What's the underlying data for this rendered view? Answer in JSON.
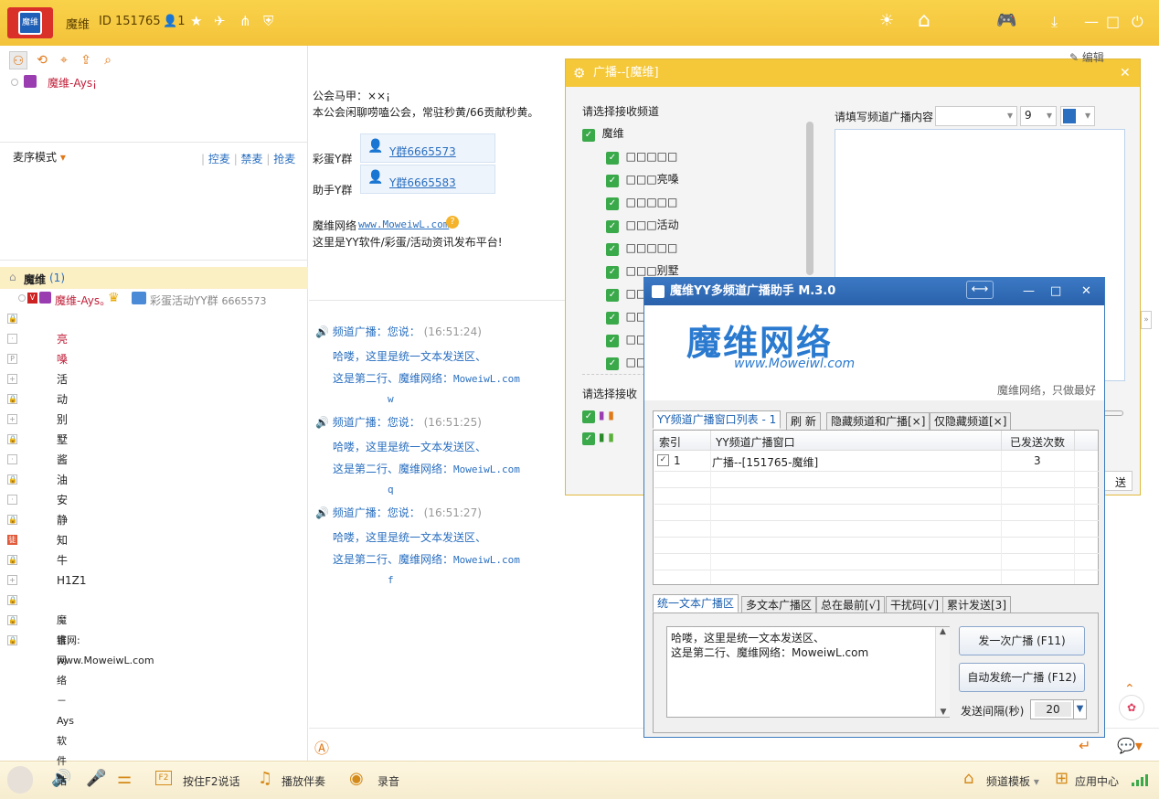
{
  "topbar": {
    "logo_text": "魔维",
    "channel_name": "魔维",
    "id_label": "ID 151765",
    "online_count": "1"
  },
  "left": {
    "user_name": "魔维-Ays¡",
    "mic_mode": "麦序模式",
    "mic_actions": [
      "控麦",
      "禁麦",
      "抢麦"
    ],
    "root_name": "魔维",
    "root_count": "(1)",
    "member_name": "魔维-Ays。",
    "member_group": "彩蛋活动YY群",
    "member_group_id": "6665573",
    "channels": [
      {
        "label": "",
        "icon": "lock"
      },
      {
        "label": "亮嗓",
        "icon": "dot"
      },
      {
        "label": "",
        "icon": "pg"
      },
      {
        "label": "活动",
        "icon": "plus"
      },
      {
        "label": "",
        "icon": "lock"
      },
      {
        "label": "别墅",
        "icon": "plus"
      },
      {
        "label": "",
        "icon": "lock"
      },
      {
        "label": "酱油",
        "icon": "dot"
      },
      {
        "label": "",
        "icon": "lock"
      },
      {
        "label": "安静",
        "icon": "dot"
      },
      {
        "label": "",
        "icon": "lock"
      },
      {
        "label": "知牛",
        "icon": "tu"
      },
      {
        "label": "",
        "icon": "lock"
      },
      {
        "label": "H1Z1",
        "icon": "plus"
      },
      {
        "label": "",
        "icon": "lock"
      },
      {
        "label": "魔维网络－Ays软件站",
        "icon": "lock"
      },
      {
        "label": "官网: www.MoweiwL.com",
        "icon": "lock"
      }
    ]
  },
  "announce": {
    "line1": "公会马甲：××¡",
    "line2": "本公会闲聊唠嗑公会，常驻秒黄/66贡献秒黄。",
    "group1_label": "彩蛋Y群",
    "group1_link": "Y群6665573",
    "group2_label": "助手Y群",
    "group2_link": "Y群6665583",
    "site_label": "魔维网络",
    "site_link": "www.MoweiwL.com",
    "site_desc": "这里是YY软件/彩蛋/活动资讯发布平台!"
  },
  "messages": [
    {
      "head": "频道广播：您说：",
      "time": "(16:51:24)",
      "l1": "哈喽，这里是统一文本发送区、",
      "l2a": "这是第二行、魔维网络：",
      "l2b": "MoweiwL.com",
      "l3": "w"
    },
    {
      "head": "频道广播：您说：",
      "time": "(16:51:25)",
      "l1": "哈喽，这里是统一文本发送区、",
      "l2a": "这是第二行、魔维网络：",
      "l2b": "MoweiwL.com",
      "l3": "q"
    },
    {
      "head": "频道广播：您说：",
      "time": "(16:51:27)",
      "l1": "哈喽，这里是统一文本发送区、",
      "l2a": "这是第二行、魔维网络：",
      "l2b": "MoweiwL.com",
      "l3": "f"
    }
  ],
  "broadcast": {
    "title": "广播--[魔维]",
    "select_label": "请选择接收频道",
    "root": "魔维",
    "subs": [
      "□□□□□",
      "□□□亮嗓",
      "□□□□□",
      "□□□活动",
      "□□□□□",
      "□□□别墅",
      "□□",
      "□□",
      "□□",
      "□□"
    ],
    "select2_label": "请选择接收",
    "content_label": "请填写频道广播内容",
    "font_size": "9",
    "edit_label": "编辑",
    "send_tail": "送"
  },
  "helper": {
    "title": "魔维YY多频道广播助手 M.3.0",
    "brand": "魔维网络",
    "brand_url": "www.Moweiwl.com",
    "slogan": "魔维网络，只做最好",
    "tabs": [
      "YY频道广播窗口列表 - 1",
      "刷 新",
      "隐藏频道和广播[×]",
      "仅隐藏频道[×]"
    ],
    "columns": [
      "索引",
      "YY频道广播窗口",
      "已发送次数"
    ],
    "rows": [
      {
        "index": "1",
        "window": "广播--[151765-魔维]",
        "count": "3"
      }
    ],
    "tabs2": [
      "统一文本广播区",
      "多文本广播区",
      "总在最前[√]",
      "干扰码[√]",
      "累计发送[3]"
    ],
    "text_line1": "哈喽，这里是统一文本发送区、",
    "text_line2": "这是第二行、魔维网络：MoweiwL.com",
    "send_once": "发一次广播 (F11)",
    "auto_send": "自动发统一广播 (F12)",
    "interval_label": "发送间隔(秒)",
    "interval_value": "20"
  },
  "bottombar": {
    "f2": "按住F2说话",
    "music": "播放伴奏",
    "record": "录音",
    "template": "频道模板",
    "apps": "应用中心"
  }
}
